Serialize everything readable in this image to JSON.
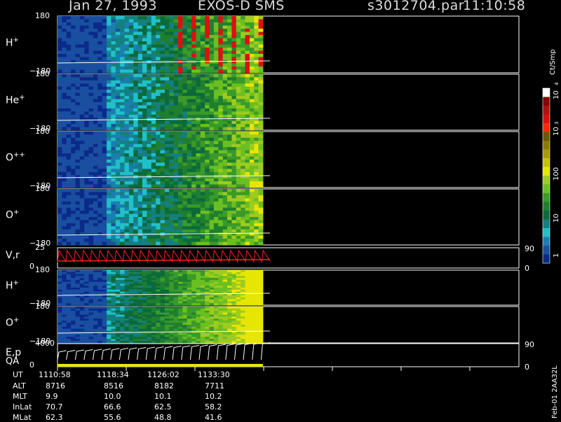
{
  "header": {
    "date": "Jan 27, 1993",
    "instrument": "EXOS-D SMS",
    "file": "s3012704.par",
    "time": "11:10:58"
  },
  "panels": [
    {
      "label": "H",
      "sup": "+",
      "y_top": "180",
      "y_bottom": "−180",
      "kind": "spec"
    },
    {
      "label": "He",
      "sup": "+",
      "y_top": "180",
      "y_bottom": "−180",
      "kind": "spec"
    },
    {
      "label": "O",
      "sup": "++",
      "y_top": "180",
      "y_bottom": "−180",
      "kind": "spec"
    },
    {
      "label": "O",
      "sup": "+",
      "y_top": "180",
      "y_bottom": "−180",
      "kind": "spec"
    },
    {
      "label": "V,r",
      "sup": "",
      "y_top": "25",
      "y_bottom": "0",
      "right_top": "90",
      "right_bottom": "0",
      "kind": "line"
    },
    {
      "label": "H",
      "sup": "+",
      "y_top": "180",
      "y_bottom": "−180",
      "kind": "spec2"
    },
    {
      "label": "O",
      "sup": "+",
      "y_top": "180",
      "y_bottom": "−180",
      "kind": "spec2"
    },
    {
      "label": "E,p",
      "sup": "",
      "y_top": "4000",
      "y_bottom": "0",
      "right_top": "90",
      "right_bottom": "0",
      "kind": "ep"
    }
  ],
  "qa_label": "QA",
  "colorbar": {
    "title": "Ct/Smp",
    "tick_labels": [
      "10",
      "4",
      "10",
      "3",
      "100",
      "10",
      "1"
    ],
    "colors": [
      "#ffffff",
      "#8b0000",
      "#b01010",
      "#dd1010",
      "#ff2a00",
      "#6b5a00",
      "#8a7a00",
      "#a89a00",
      "#c8c000",
      "#e6e600",
      "#9ecb1f",
      "#6bbf20",
      "#3a9a2a",
      "#1f7f2f",
      "#0c6a3a",
      "#137f7f",
      "#20c0c8",
      "#1a7fb0",
      "#1a4fa0",
      "#0a2a8a"
    ]
  },
  "footer": {
    "rows": [
      {
        "name": "UT",
        "values": [
          "1110:58",
          "1118:34",
          "1126:02",
          "1133:30"
        ]
      },
      {
        "name": "ALT",
        "values": [
          "8716",
          "8516",
          "8182",
          "7711"
        ]
      },
      {
        "name": "MLT",
        "values": [
          "9.9",
          "10.0",
          "10.1",
          "10.2"
        ]
      },
      {
        "name": "InLat",
        "values": [
          "70.7",
          "66.6",
          "62.5",
          "58.2"
        ]
      },
      {
        "name": "MLat",
        "values": [
          "62.3",
          "55.6",
          "48.8",
          "41.6"
        ]
      }
    ]
  },
  "side_note": "Feb-01 2AA32L",
  "chart_data": {
    "type": "heatmap",
    "title": "Jan 27, 1993   EXOS-D SMS",
    "x_ticks": [
      "1110:58",
      "1118:34",
      "1126:02",
      "1133:30"
    ],
    "series": [
      {
        "name": "H+",
        "y_range": [
          -180,
          180
        ]
      },
      {
        "name": "He+",
        "y_range": [
          -180,
          180
        ]
      },
      {
        "name": "O++",
        "y_range": [
          -180,
          180
        ]
      },
      {
        "name": "O+",
        "y_range": [
          -180,
          180
        ]
      },
      {
        "name": "V,r",
        "y_range": [
          0,
          25
        ]
      },
      {
        "name": "H+",
        "y_range": [
          -180,
          180
        ]
      },
      {
        "name": "O+",
        "y_range": [
          -180,
          180
        ]
      },
      {
        "name": "E,p",
        "y_range": [
          0,
          4000
        ]
      }
    ],
    "colorbar_units": "Ct/Smp",
    "colorbar_range": [
      "1",
      "10^4"
    ]
  }
}
